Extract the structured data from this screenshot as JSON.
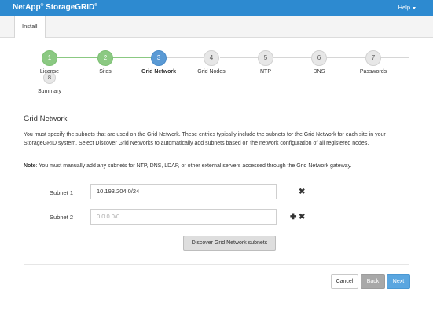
{
  "header": {
    "brand_main": "NetApp",
    "brand_sup": "®",
    "brand_product": "StorageGRID",
    "brand_sup2": "®",
    "help_label": "Help"
  },
  "tabs": [
    {
      "label": "Install"
    }
  ],
  "steps": [
    {
      "number": "1",
      "label": "License",
      "state": "done"
    },
    {
      "number": "2",
      "label": "Sites",
      "state": "done"
    },
    {
      "number": "3",
      "label": "Grid Network",
      "state": "current"
    },
    {
      "number": "4",
      "label": "Grid Nodes",
      "state": "pending"
    },
    {
      "number": "5",
      "label": "NTP",
      "state": "pending"
    },
    {
      "number": "6",
      "label": "DNS",
      "state": "pending"
    },
    {
      "number": "7",
      "label": "Passwords",
      "state": "pending"
    },
    {
      "number": "8",
      "label": "Summary",
      "state": "pending"
    }
  ],
  "section": {
    "title": "Grid Network",
    "intro": "You must specify the subnets that are used on the Grid Network. These entries typically include the subnets for the Grid Network for each site in your StorageGRID system. Select Discover Grid Networks to automatically add subnets based on the network configuration of all registered nodes.",
    "note_label": "Note",
    "note_text": ": You must manually add any subnets for NTP, DNS, LDAP, or other external servers accessed through the Grid Network gateway."
  },
  "subnets": [
    {
      "label": "Subnet 1",
      "value": "10.193.204.0/24",
      "placeholder": ""
    },
    {
      "label": "Subnet 2",
      "value": "",
      "placeholder": "0.0.0.0/0"
    }
  ],
  "icons": {
    "remove": "✖",
    "add": "✚"
  },
  "buttons": {
    "discover": "Discover Grid Network subnets",
    "cancel": "Cancel",
    "back": "Back",
    "next": "Next"
  },
  "colors": {
    "header": "#2d8ad0",
    "step_done": "#8bc982",
    "step_current": "#5a9ad5",
    "step_pending": "#e7e7e7",
    "next_button": "#5aa6e0"
  }
}
